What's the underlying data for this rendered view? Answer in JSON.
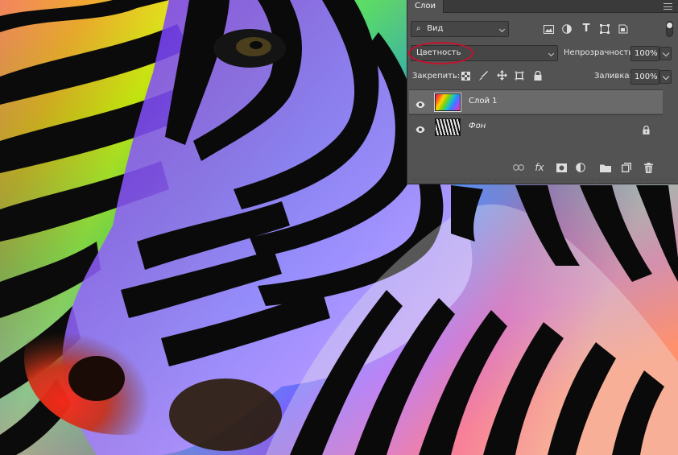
{
  "panel": {
    "tab_label": "Слои",
    "filter": {
      "label": "Вид"
    },
    "blend_mode": "Цветность",
    "opacity_label": "Непрозрачность:",
    "opacity_value": "100%",
    "lock_label": "Закрепить:",
    "fill_label": "Заливка:",
    "fill_value": "100%",
    "layers": [
      {
        "name": "Слой 1",
        "selected": true,
        "visible": true
      },
      {
        "name": "Фон",
        "selected": false,
        "visible": true,
        "locked": true
      }
    ],
    "annotation_color": "#c8102e"
  },
  "icons": {
    "filter_icons": [
      "image-filter-icon",
      "adjustment-filter-icon",
      "type-filter-icon",
      "shape-filter-icon",
      "smart-object-filter-icon"
    ],
    "lock_icons": [
      "lock-transparent-pixels-icon",
      "lock-image-pixels-icon",
      "lock-position-icon",
      "lock-artboard-icon",
      "lock-all-icon"
    ],
    "bottom_icons": [
      "link-layers-icon",
      "layer-style-icon",
      "add-mask-icon",
      "adjustment-layer-icon",
      "new-group-icon",
      "new-layer-icon",
      "delete-layer-icon"
    ]
  },
  "colors": {
    "panel_bg": "#535353",
    "selected_row": "#6a6a6a",
    "tab_bar": "#3a3a3a"
  }
}
